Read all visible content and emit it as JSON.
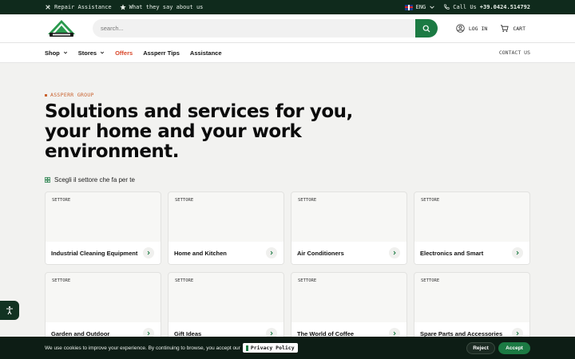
{
  "topbar": {
    "repair": "Repair Assistance",
    "reviews": "What they say about us",
    "language": "ENG",
    "call_label": "Call Us",
    "phone": "+39.0424.514792"
  },
  "header": {
    "search_placeholder": "search...",
    "login": "LOG IN",
    "cart": "CART"
  },
  "nav": {
    "items": [
      {
        "label": "Shop"
      },
      {
        "label": "Stores"
      },
      {
        "label": "Offers"
      },
      {
        "label": "Assperr Tips"
      },
      {
        "label": "Assistance"
      }
    ],
    "contact": "CONTACT US"
  },
  "hero": {
    "eyebrow": "ASSPERR GROUP",
    "title": "Solutions and services for you, your home and your work environment.",
    "sector_hint": "Scegli il settore che fa per te"
  },
  "cards": [
    {
      "tag": "SETTORE",
      "name": "Industrial Cleaning Equipment"
    },
    {
      "tag": "SETTORE",
      "name": "Home and Kitchen"
    },
    {
      "tag": "SETTORE",
      "name": "Air Conditioners"
    },
    {
      "tag": "SETTORE",
      "name": "Electronics and Smart"
    },
    {
      "tag": "SETTORE",
      "name": "Garden and Outdoor"
    },
    {
      "tag": "SETTORE",
      "name": "Gift Ideas"
    },
    {
      "tag": "SETTORE",
      "name": "The World of Coffee"
    },
    {
      "tag": "SETTORE",
      "name": "Spare Parts and Accessories"
    }
  ],
  "cookie": {
    "message": "We use cookies to improve your experience. By continuing to browse, you accept our",
    "policy": "Privacy Policy",
    "reject": "Reject",
    "accept": "Accept"
  },
  "colors": {
    "brand_green": "#1b7a43",
    "dark_green": "#0f2a1c",
    "accent_orange": "#c9622e",
    "offers_red": "#d9482b"
  }
}
